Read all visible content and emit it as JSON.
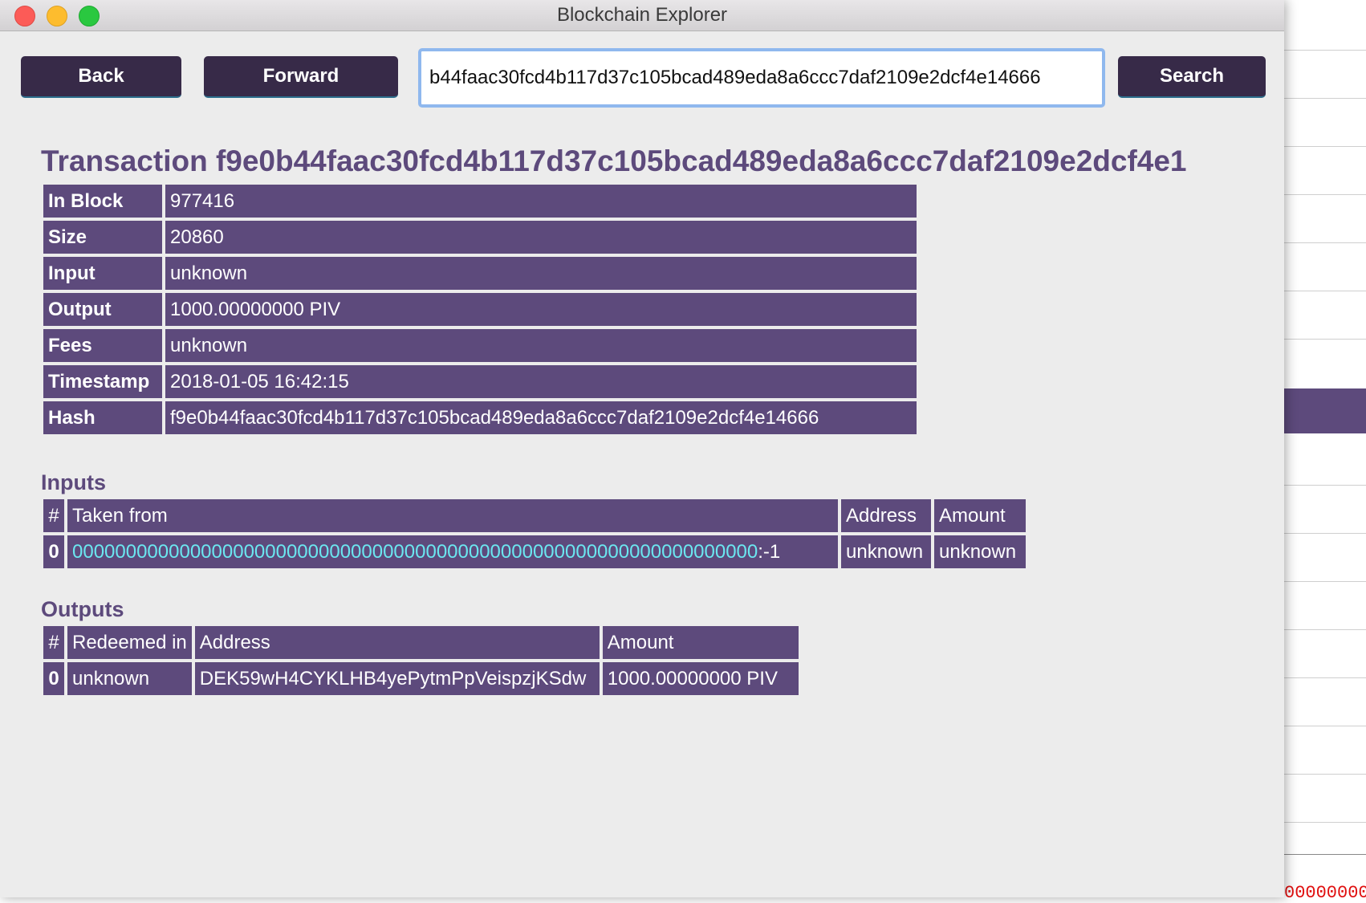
{
  "window": {
    "title": "Blockchain Explorer"
  },
  "toolbar": {
    "back_label": "Back",
    "forward_label": "Forward",
    "search_value": "b44faac30fcd4b117d37c105bcad489eda8a6ccc7daf2109e2dcf4e14666",
    "search_label": "Search"
  },
  "transaction": {
    "heading": "Transaction f9e0b44faac30fcd4b117d37c105bcad489eda8a6ccc7daf2109e2dcf4e1",
    "rows": [
      {
        "key": "In Block",
        "value": "977416"
      },
      {
        "key": "Size",
        "value": "20860"
      },
      {
        "key": "Input",
        "value": "unknown"
      },
      {
        "key": "Output",
        "value": "1000.00000000 PIV"
      },
      {
        "key": "Fees",
        "value": "unknown"
      },
      {
        "key": "Timestamp",
        "value": "2018-01-05 16:42:15"
      },
      {
        "key": "Hash",
        "value": "f9e0b44faac30fcd4b117d37c105bcad489eda8a6ccc7daf2109e2dcf4e14666"
      }
    ]
  },
  "inputs": {
    "heading": "Inputs",
    "columns": [
      "#",
      "Taken from",
      "Address",
      "Amount"
    ],
    "rows": [
      {
        "index": "0",
        "taken_from": "0000000000000000000000000000000000000000000000000000000000000000",
        "taken_from_suffix": ":-1",
        "address": "unknown",
        "amount": "unknown"
      }
    ]
  },
  "outputs": {
    "heading": "Outputs",
    "columns": [
      "#",
      "Redeemed in",
      "Address",
      "Amount"
    ],
    "rows": [
      {
        "index": "0",
        "redeemed_in": "unknown",
        "address": "DEK59wH4CYKLHB4yePytmPpVeispzjKSdw",
        "amount": "1000.00000000 PIV"
      }
    ]
  },
  "colors": {
    "accent": "#5d4a7c",
    "button": "#372a48",
    "link": "#6be7f0"
  },
  "background_window": {
    "visible_text": "00000000"
  }
}
